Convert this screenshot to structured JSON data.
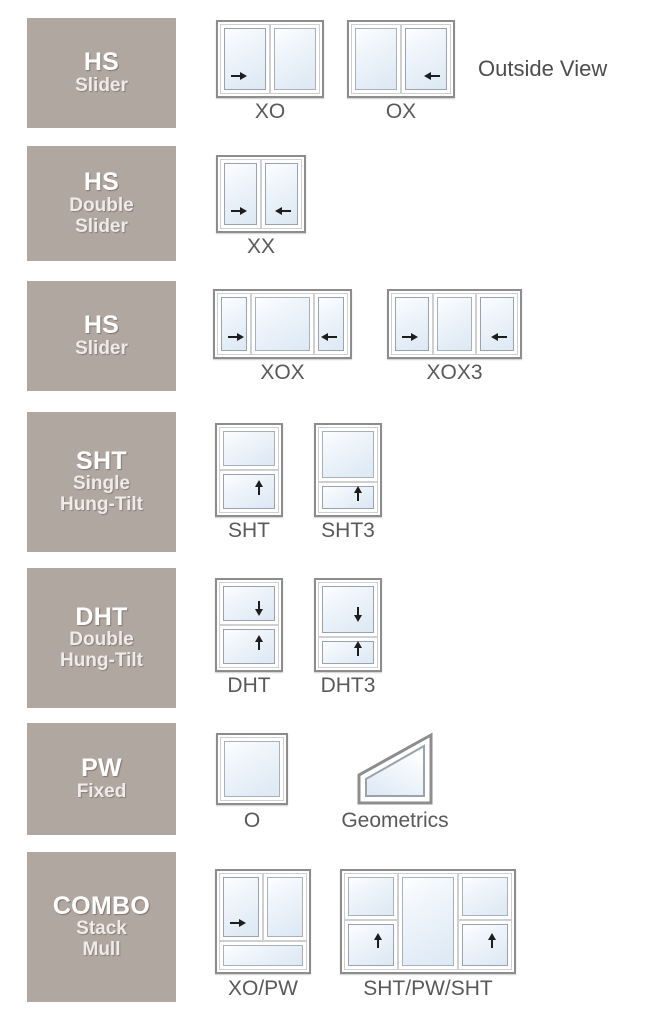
{
  "note": {
    "outside_view": "Outside View"
  },
  "palette": {
    "label_block_bg": "#b1a7a1",
    "label_text": "#ffffff",
    "caption_text": "#595959",
    "frame": "#8d8d8d",
    "glass_light": "#fdfeff",
    "glass_dark": "#dce8f4",
    "note_text": "#4d4d4d"
  },
  "rows": [
    {
      "code": "HS",
      "sub": [
        "Slider"
      ],
      "figures": [
        {
          "caption": "XO",
          "type": "horizontal",
          "panels": [
            "operable-right-arrow",
            "fixed"
          ]
        },
        {
          "caption": "OX",
          "type": "horizontal",
          "panels": [
            "fixed",
            "operable-left-arrow"
          ]
        }
      ]
    },
    {
      "code": "HS",
      "sub": [
        "Double",
        "Slider"
      ],
      "figures": [
        {
          "caption": "XX",
          "type": "horizontal",
          "panels": [
            "operable-right-arrow",
            "operable-left-arrow"
          ]
        }
      ]
    },
    {
      "code": "HS",
      "sub": [
        "Slider"
      ],
      "figures": [
        {
          "caption": "XOX",
          "type": "horizontal",
          "panels": [
            "operable-right-arrow",
            "fixed-wide",
            "operable-left-arrow"
          ]
        },
        {
          "caption": "XOX3",
          "type": "horizontal",
          "panels": [
            "operable-right-arrow",
            "fixed",
            "operable-left-arrow"
          ]
        }
      ]
    },
    {
      "code": "SHT",
      "sub": [
        "Single",
        "Hung-Tilt"
      ],
      "figures": [
        {
          "caption": "SHT",
          "type": "vertical",
          "panels": [
            "fixed",
            "operable-up-arrow"
          ]
        },
        {
          "caption": "SHT3",
          "type": "vertical",
          "panels": [
            "fixed-tall",
            "operable-up-arrow-short"
          ]
        }
      ]
    },
    {
      "code": "DHT",
      "sub": [
        "Double",
        "Hung-Tilt"
      ],
      "figures": [
        {
          "caption": "DHT",
          "type": "vertical",
          "panels": [
            "operable-down-arrow",
            "operable-up-arrow"
          ]
        },
        {
          "caption": "DHT3",
          "type": "vertical",
          "panels": [
            "operable-down-arrow-tall",
            "operable-up-arrow-short"
          ]
        }
      ]
    },
    {
      "code": "PW",
      "sub": [
        "Fixed"
      ],
      "figures": [
        {
          "caption": "O",
          "type": "single",
          "panels": [
            "fixed"
          ]
        },
        {
          "caption": "Geometrics",
          "type": "geometric",
          "panels": [
            "trapezoid"
          ]
        }
      ]
    },
    {
      "code": "COMBO",
      "sub": [
        "Stack",
        "Mull"
      ],
      "figures": [
        {
          "caption": "XO/PW",
          "type": "combo-stack",
          "panels": [
            "operable-right-arrow",
            "fixed",
            "transom-fixed"
          ]
        },
        {
          "caption": "SHT/PW/SHT",
          "type": "combo-mull",
          "panels": [
            "sht",
            "fixed-tall-center",
            "sht"
          ]
        }
      ]
    }
  ]
}
